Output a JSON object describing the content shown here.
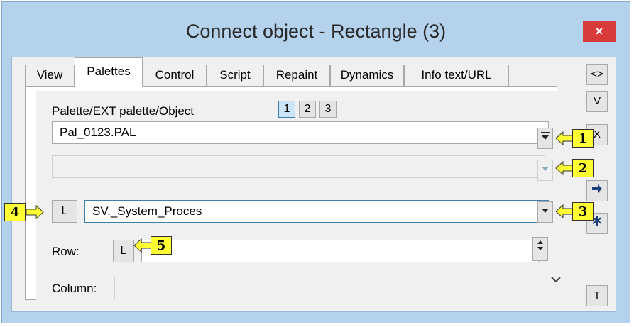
{
  "window": {
    "title": "Connect object - Rectangle (3)",
    "close_label": "×"
  },
  "tabs": [
    {
      "label": "View"
    },
    {
      "label": "Palettes"
    },
    {
      "label": "Control"
    },
    {
      "label": "Script"
    },
    {
      "label": "Repaint"
    },
    {
      "label": "Dynamics"
    },
    {
      "label": "Info text/URL"
    }
  ],
  "active_tab": "Palettes",
  "palette": {
    "label": "Palette/EXT palette/Object",
    "numbers": [
      "1",
      "2",
      "3"
    ],
    "selected_number": "1",
    "value": "Pal_0123.PAL"
  },
  "second_field": {
    "value": ""
  },
  "object": {
    "l_label": "L",
    "value": "SV._System_Proces"
  },
  "row": {
    "label": "Row:",
    "l_label": "L",
    "value": ""
  },
  "column": {
    "label": "Column:",
    "value": ""
  },
  "side_buttons": [
    "<>",
    "V",
    "X",
    "T"
  ],
  "callouts": [
    "1",
    "2",
    "3",
    "4",
    "5"
  ],
  "colors": {
    "callout": "#ffff33",
    "title_bg": "#b4d2eb",
    "close": "#d83b3b"
  }
}
